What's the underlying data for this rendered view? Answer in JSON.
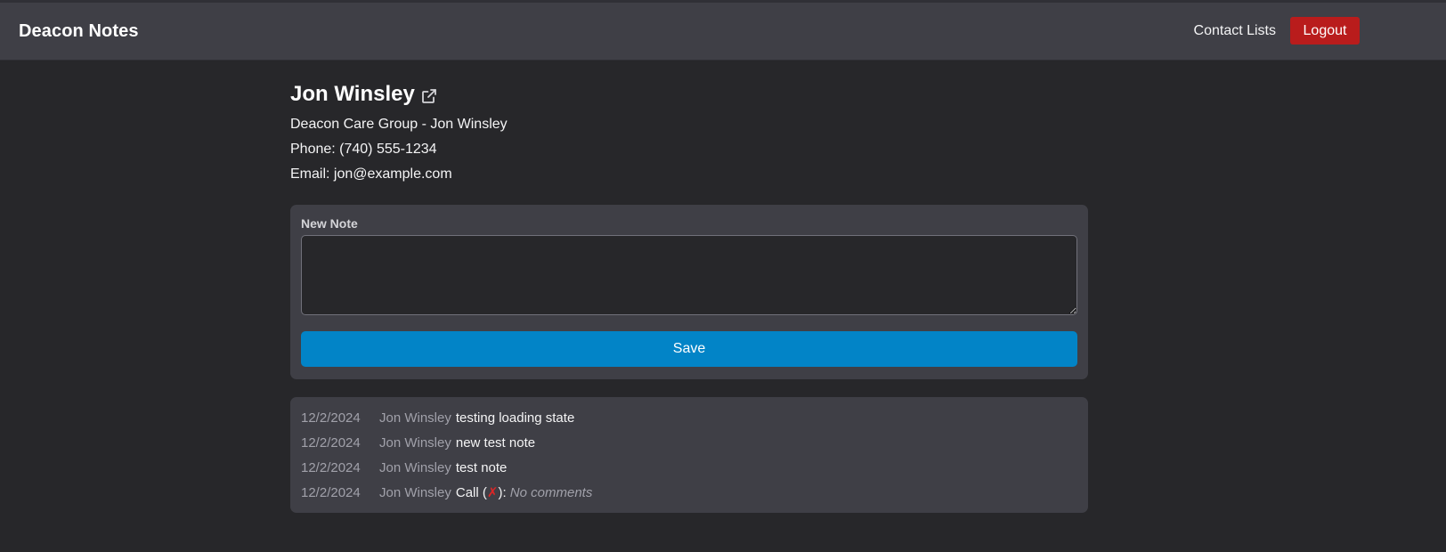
{
  "app": {
    "brand": "Deacon Notes"
  },
  "nav": {
    "contact_lists": "Contact Lists",
    "logout": "Logout"
  },
  "contact": {
    "name": "Jon Winsley",
    "group": "Deacon Care Group - Jon Winsley",
    "phone": "Phone: (740) 555-1234",
    "email": "Email: jon@example.com",
    "link_icon": "external-link-icon"
  },
  "new_note": {
    "label": "New Note",
    "value": "",
    "placeholder": "",
    "save_label": "Save"
  },
  "notes": [
    {
      "date": "12/2/2024",
      "author": "Jon Winsley",
      "text": "testing loading state"
    },
    {
      "date": "12/2/2024",
      "author": "Jon Winsley",
      "text": "new test note"
    },
    {
      "date": "12/2/2024",
      "author": "Jon Winsley",
      "text": "test note"
    },
    {
      "date": "12/2/2024",
      "author": "Jon Winsley",
      "call_prefix": "Call (",
      "call_status": "✗",
      "call_suffix": "):",
      "comment": "No comments"
    }
  ],
  "colors": {
    "accent": "#0284c7",
    "danger": "#b91c1c",
    "call_failed": "#dc2626"
  }
}
